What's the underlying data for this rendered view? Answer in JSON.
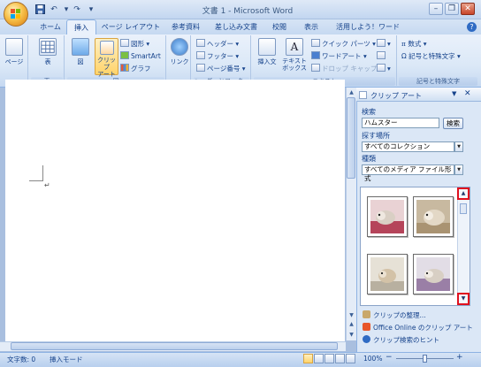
{
  "window": {
    "title": "文書 1 - Microsoft Word",
    "buttons": {
      "minimize": "–",
      "restore": "❐",
      "close": "✕"
    }
  },
  "quick_access": {
    "save_icon": "save-icon",
    "undo": "↶",
    "redo": "↷",
    "more": "▾"
  },
  "tabs": [
    "ホーム",
    "挿入",
    "ページ レイアウト",
    "参考資料",
    "差し込み文書",
    "校閲",
    "表示",
    "活用しよう！ワード"
  ],
  "active_tab": "挿入",
  "ribbon": {
    "page_btn": "ページ",
    "table_btn": "表",
    "picture_btn": "図",
    "clipart_btn": [
      "クリップ",
      "アート"
    ],
    "shapes_btn": "図形",
    "smartart_btn": "SmartArt",
    "chart_btn": "グラフ",
    "link_btn": "リンク",
    "header_btn": "ヘッダー",
    "footer_btn": "フッター",
    "pagenum_btn": "ページ番号",
    "textbox_btn": "挿入文",
    "textbox2_btn": [
      "テキスト",
      "ボックス"
    ],
    "quickparts_btn": "クイック パーツ",
    "wordart_btn": "ワードアート",
    "dropcap_btn": "ドロップ キャップ",
    "equation_btn": "数式",
    "symbol_btn": "記号と特殊文字",
    "groups": {
      "table": "表",
      "illustrations": "図",
      "headerfooter": "ヘッダーとフッター",
      "text": "テキスト",
      "symbols": "記号と特殊文字"
    }
  },
  "document": {
    "paragraph_mark": "↵"
  },
  "taskpane": {
    "title": "クリップ アート",
    "search_label": "検索",
    "search_value": "ハムスター",
    "search_button": "検索",
    "location_label": "探す場所",
    "location_value": "すべてのコレクション",
    "type_label": "種類",
    "type_value": "すべてのメディア ファイル形式",
    "links": [
      "クリップの整理...",
      "Office Online のクリップ アート",
      "クリップ検索のヒント"
    ]
  },
  "status": {
    "wordcount": "文字数: 0",
    "mode": "挿入モード",
    "zoom": "100%",
    "zoom_minus": "−",
    "zoom_plus": "+"
  },
  "colors": {
    "ribbon_blue": "#c4d7f0",
    "highlight_red": "#e0101e",
    "active_btn": "#ffd36a"
  }
}
